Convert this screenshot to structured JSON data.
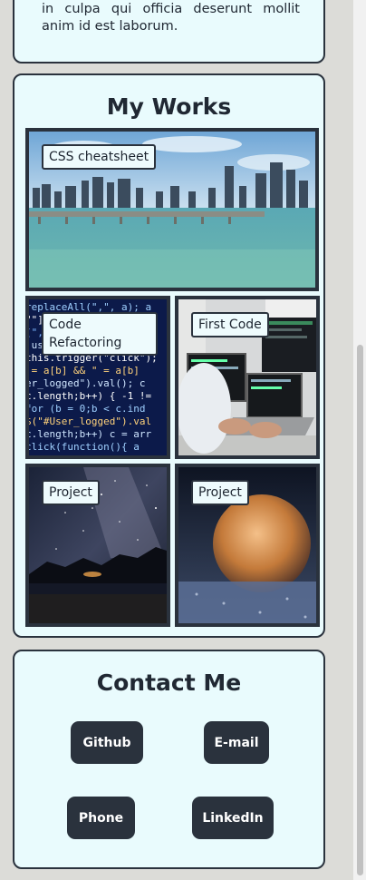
{
  "about": {
    "text": "in culpa qui officia deserunt mollit anim id est laborum."
  },
  "works": {
    "title": "My Works",
    "items": [
      {
        "label": "CSS cheatsheet",
        "image": "city-waterfront-photo"
      },
      {
        "label": "Code Refactoring",
        "image": "code-screen-photo"
      },
      {
        "label": "First Code",
        "image": "laptop-coder-photo"
      },
      {
        "label": "Project",
        "image": "night-sky-lake-photo"
      },
      {
        "label": "Project",
        "image": "frozen-bubble-photo"
      }
    ]
  },
  "contact": {
    "title": "Contact Me",
    "buttons": [
      {
        "label": "Github"
      },
      {
        "label": "E-mail"
      },
      {
        "label": "Phone"
      },
      {
        "label": "LinkedIn"
      }
    ]
  },
  "colors": {
    "card_bg": "#e9fbfd",
    "border": "#2a323d",
    "button_bg": "#2a323d",
    "page_bg": "#dcdcd8"
  }
}
